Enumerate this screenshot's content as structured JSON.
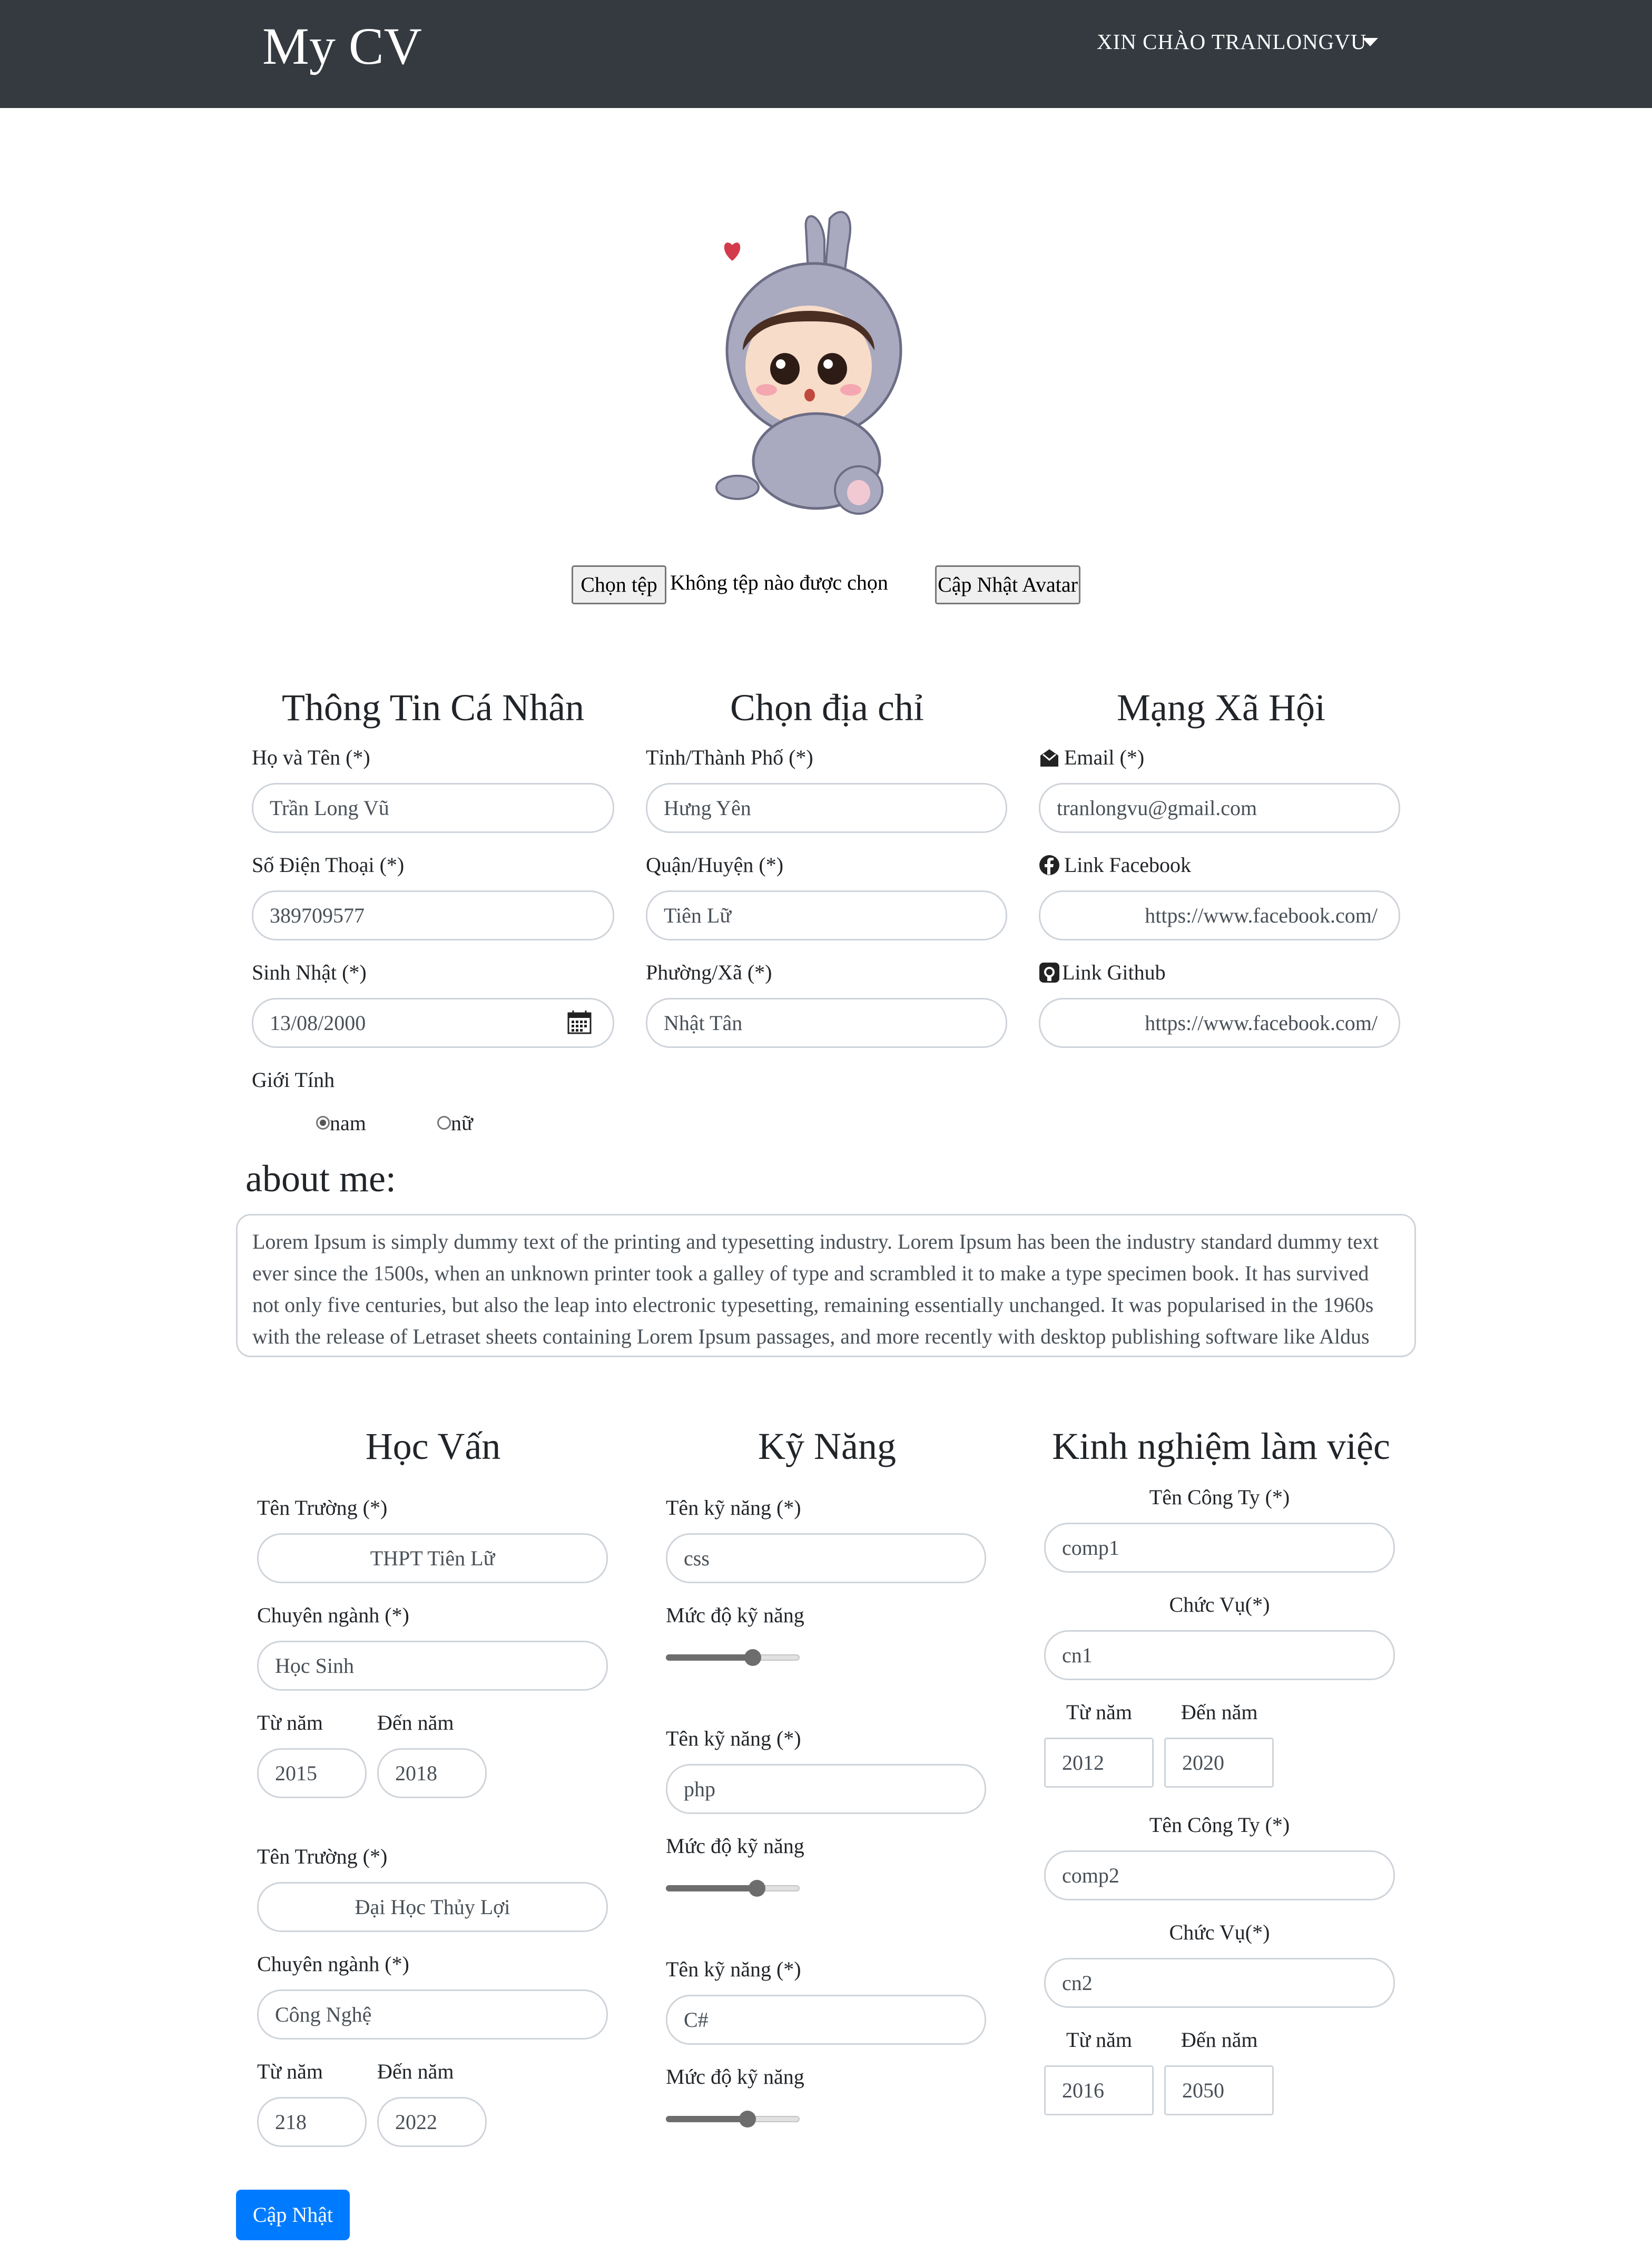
{
  "header": {
    "brand": "My CV",
    "greeting": "XIN CHÀO TRANLONGVU"
  },
  "avatar": {
    "choose_file_label": "Chọn tệp",
    "file_status": "Không tệp nào được chọn",
    "update_label": "Cập Nhật Avatar"
  },
  "personal": {
    "title": "Thông Tin Cá Nhân",
    "name_label": "Họ và Tên (*)",
    "name_value": "Trần Long Vũ",
    "phone_label": "Số Điện Thoại (*)",
    "phone_value": "389709577",
    "birthday_label": "Sinh Nhật (*)",
    "birthday_value": "13/08/2000",
    "gender_label": "Giới Tính",
    "gender_options": [
      "nam",
      "nữ"
    ],
    "gender_selected": "nam"
  },
  "address": {
    "title": "Chọn địa chỉ",
    "province_label": "Tỉnh/Thành Phố (*)",
    "province_value": "Hưng Yên",
    "district_label": "Quận/Huyện (*)",
    "district_value": "Tiên Lữ",
    "ward_label": "Phường/Xã (*)",
    "ward_value": "Nhật Tân"
  },
  "social": {
    "title": "Mạng Xã Hội",
    "email_label": "Email (*)",
    "email_value": "tranlongvu@gmail.com",
    "facebook_label": "Link Facebook",
    "facebook_value": "https://www.facebook.com/",
    "github_label": "Link Github",
    "github_value": "https://www.facebook.com/"
  },
  "about": {
    "title": "about me:",
    "text": "Lorem Ipsum is simply dummy text of the printing and typesetting industry. Lorem Ipsum has been the industry standard dummy text ever since the 1500s, when an unknown printer took a galley of type and scrambled it to make a type specimen book. It has survived not only five centuries, but also the leap into electronic typesetting, remaining essentially unchanged. It was popularised in the 1960s with the release of Letraset sheets containing Lorem Ipsum passages, and more recently with desktop publishing software like Aldus"
  },
  "education": {
    "title": "Học Vấn",
    "school_label": "Tên Trường (*)",
    "major_label": "Chuyên ngành (*)",
    "from_label": "Từ năm",
    "to_label": "Đến năm",
    "entries": [
      {
        "school": "THPT Tiên Lữ",
        "major": "Học Sinh",
        "from": "2015",
        "to": "2018"
      },
      {
        "school": "Đại Học Thủy Lợi",
        "major": "Công Nghệ",
        "from": "218",
        "to": "2022"
      }
    ]
  },
  "skills": {
    "title": "Kỹ Năng",
    "name_label": "Tên kỹ năng (*)",
    "level_label": "Mức độ kỹ năng",
    "entries": [
      {
        "name": "css",
        "level": 0.65
      },
      {
        "name": "php",
        "level": 0.68
      },
      {
        "name": "C#",
        "level": 0.61
      }
    ]
  },
  "experience": {
    "title": "Kinh nghiệm làm việc",
    "company_label": "Tên Công Ty (*)",
    "position_label": "Chức Vụ(*)",
    "from_label": "Từ năm",
    "to_label": "Đến năm",
    "entries": [
      {
        "company": "comp1",
        "position": "cn1",
        "from": "2012",
        "to": "2020"
      },
      {
        "company": "comp2",
        "position": "cn2",
        "from": "2016",
        "to": "2050"
      }
    ]
  },
  "submit_label": "Cập Nhật"
}
